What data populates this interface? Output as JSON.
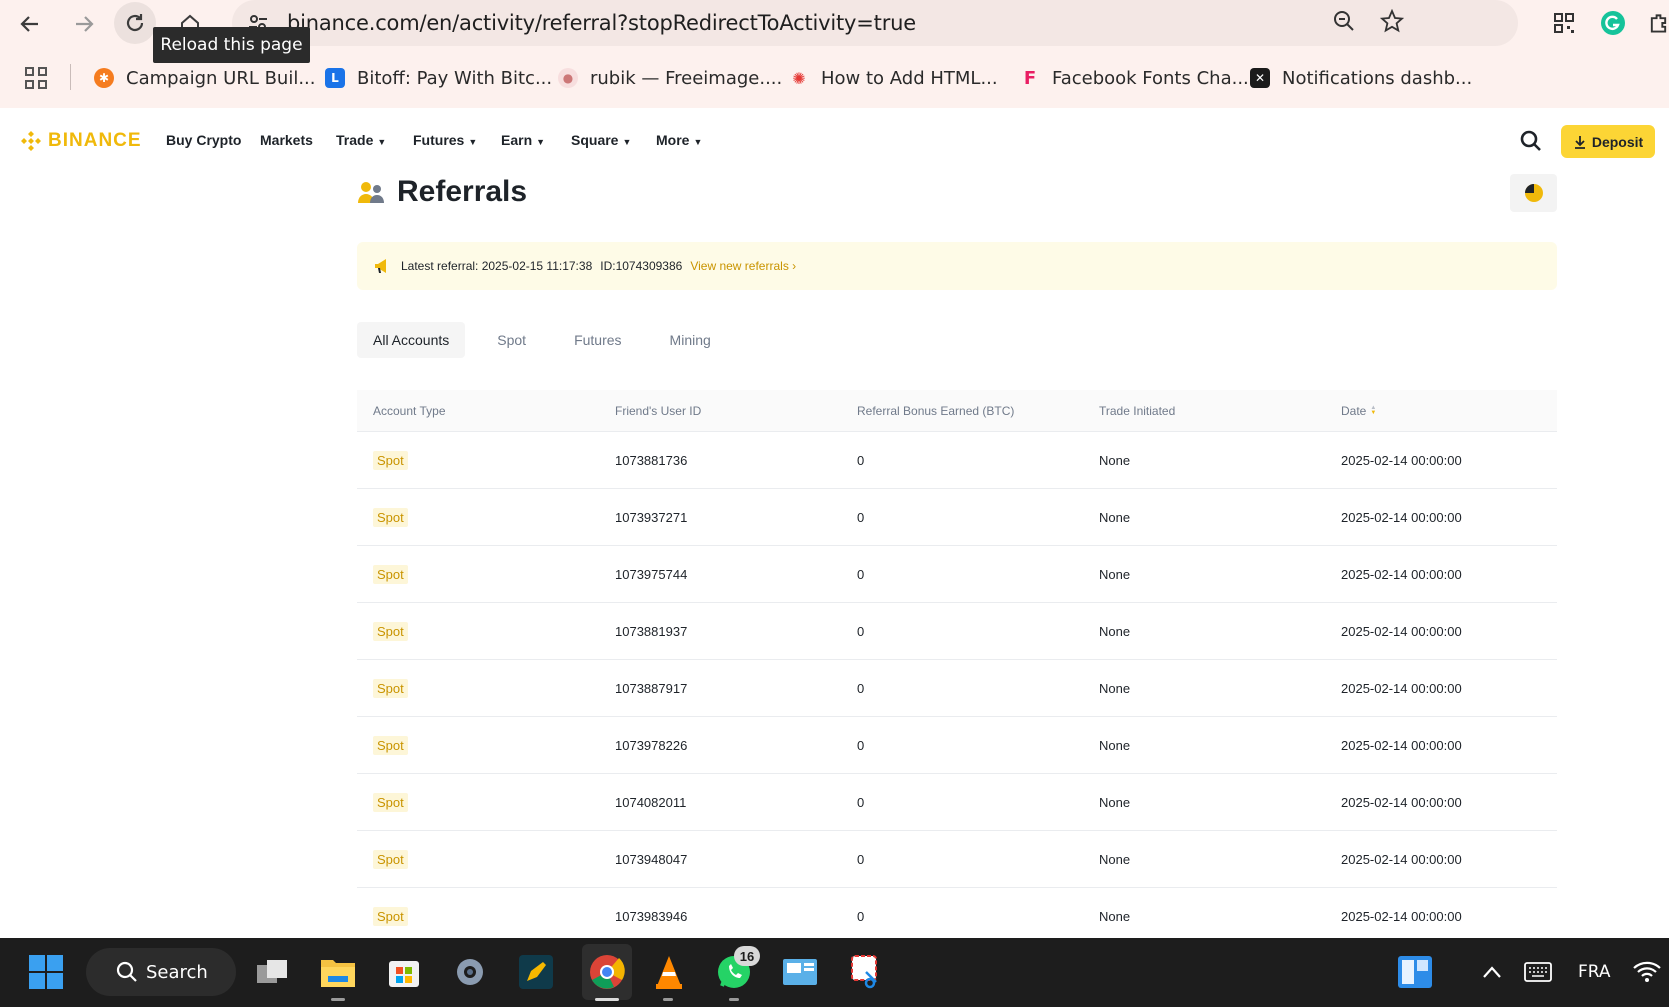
{
  "browser": {
    "url": "binance.com/en/activity/referral?stopRedirectToActivity=true",
    "tooltip": "Reload this page",
    "bookmarks": [
      {
        "label": "Campaign URL Buil...",
        "icon": "campaign-url-builder-icon",
        "color": "#f57c1f"
      },
      {
        "label": "Bitoff: Pay With Bitc...",
        "icon": "bitoff-icon",
        "color": "#1a73e8"
      },
      {
        "label": "rubik — Freeimage....",
        "icon": "freeimage-icon",
        "color": "#e8a0a0"
      },
      {
        "label": "How to Add HTML...",
        "icon": "html-guide-icon",
        "color": "#e53935"
      },
      {
        "label": "Facebook Fonts Cha...",
        "icon": "facebook-fonts-icon",
        "color": "#e91e63"
      },
      {
        "label": "Notifications dashb...",
        "icon": "notifications-dashboard-icon",
        "color": "#1b1b1b"
      }
    ]
  },
  "site_nav": {
    "logo": "BINANCE",
    "items": [
      {
        "label": "Buy Crypto",
        "dropdown": false
      },
      {
        "label": "Markets",
        "dropdown": false
      },
      {
        "label": "Trade",
        "dropdown": true
      },
      {
        "label": "Futures",
        "dropdown": true
      },
      {
        "label": "Earn",
        "dropdown": true
      },
      {
        "label": "Square",
        "dropdown": true
      },
      {
        "label": "More",
        "dropdown": true
      }
    ],
    "deposit_label": "Deposit",
    "accent": "#F0B90B"
  },
  "page": {
    "title": "Referrals",
    "notice": {
      "latest": "Latest referral: 2025-02-15 11:17:38",
      "id": "ID:1074309386",
      "link": "View new referrals ›"
    },
    "tabs": [
      "All Accounts",
      "Spot",
      "Futures",
      "Mining"
    ],
    "active_tab": "All Accounts"
  },
  "table": {
    "headers": [
      "Account Type",
      "Friend's User ID",
      "Referral Bonus Earned (BTC)",
      "Trade Initiated",
      "Date"
    ],
    "rows": [
      [
        "Spot",
        "1073881736",
        "0",
        "None",
        "2025-02-14 00:00:00"
      ],
      [
        "Spot",
        "1073937271",
        "0",
        "None",
        "2025-02-14 00:00:00"
      ],
      [
        "Spot",
        "1073975744",
        "0",
        "None",
        "2025-02-14 00:00:00"
      ],
      [
        "Spot",
        "1073881937",
        "0",
        "None",
        "2025-02-14 00:00:00"
      ],
      [
        "Spot",
        "1073887917",
        "0",
        "None",
        "2025-02-14 00:00:00"
      ],
      [
        "Spot",
        "1073978226",
        "0",
        "None",
        "2025-02-14 00:00:00"
      ],
      [
        "Spot",
        "1074082011",
        "0",
        "None",
        "2025-02-14 00:00:00"
      ],
      [
        "Spot",
        "1073948047",
        "0",
        "None",
        "2025-02-14 00:00:00"
      ],
      [
        "Spot",
        "1073983946",
        "0",
        "None",
        "2025-02-14 00:00:00"
      ]
    ]
  },
  "taskbar": {
    "search_label": "Search",
    "whatsapp_badge": "16",
    "language": "FRA"
  }
}
